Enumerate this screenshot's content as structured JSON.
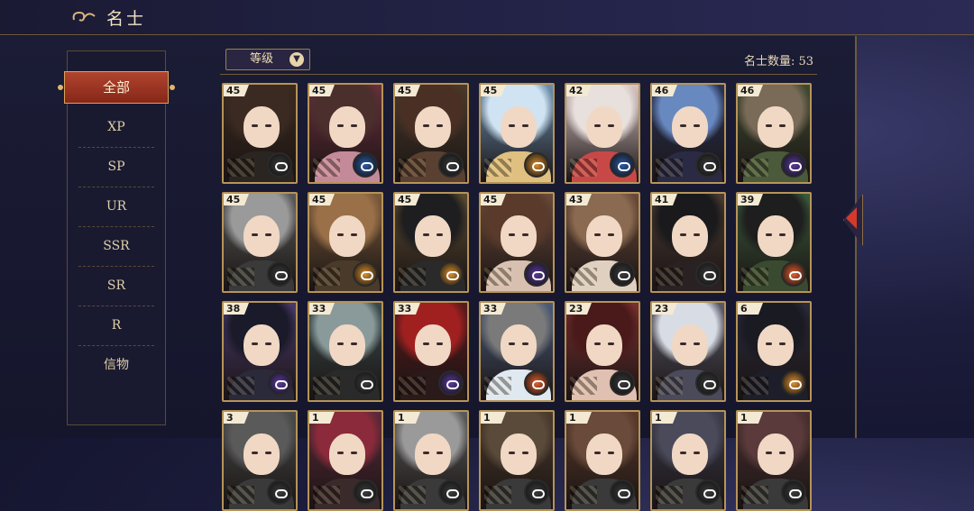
{
  "header": {
    "title": "名士",
    "icon": "cloud-swirl-icon"
  },
  "sidebar": {
    "items": [
      {
        "label": "全部",
        "active": true
      },
      {
        "label": "XP"
      },
      {
        "label": "SP"
      },
      {
        "label": "UR"
      },
      {
        "label": "SSR"
      },
      {
        "label": "SR"
      },
      {
        "label": "R"
      },
      {
        "label": "信物"
      }
    ]
  },
  "toolbar": {
    "sort_label": "等级",
    "sort_icon": "chevron-down-icon",
    "count_text": "名士数量: 53"
  },
  "side_tab": {
    "icon": "arrow-left-icon"
  },
  "cards": [
    {
      "level": "45",
      "hair": "#3a2a22",
      "bg": "#3b2a1e",
      "body": "#2a2520",
      "badge": "#3a3a3a"
    },
    {
      "level": "45",
      "hair": "#4a2f2c",
      "bg": "#6a2f3c",
      "body": "#c58a9a",
      "badge": "#2d5aa6"
    },
    {
      "level": "45",
      "hair": "#4a3024",
      "bg": "#4a3a2a",
      "body": "#5a4030",
      "badge": "#3a3a3a"
    },
    {
      "level": "45",
      "hair": "#cfe3f2",
      "bg": "#6b8fb0",
      "body": "#e0c080",
      "badge": "#d89030"
    },
    {
      "level": "42",
      "hair": "#e8e0dc",
      "bg": "#d8c4c4",
      "body": "#c84848",
      "badge": "#2d5aa6"
    },
    {
      "level": "46",
      "hair": "#6888c0",
      "bg": "#2a3458",
      "body": "#2a2a44",
      "badge": "#3a3a3a"
    },
    {
      "level": "46",
      "hair": "#7a6a58",
      "bg": "#3e4a30",
      "body": "#4a5a3a",
      "badge": "#5a3a9a"
    },
    {
      "level": "45",
      "hair": "#9a9a9a",
      "bg": "#5a5a5a",
      "body": "#3a3a3a",
      "badge": "#3a3a3a"
    },
    {
      "level": "45",
      "hair": "#9a7048",
      "bg": "#7a5a3a",
      "body": "#4a3a2a",
      "badge": "#d89030"
    },
    {
      "level": "45",
      "hair": "#1e1e20",
      "bg": "#5a4a30",
      "body": "#2a2a2a",
      "badge": "#d89030"
    },
    {
      "level": "45",
      "hair": "#5a3a2a",
      "bg": "#6a4a3a",
      "body": "#d8c0b0",
      "badge": "#5a3a9a"
    },
    {
      "level": "43",
      "hair": "#8a6a50",
      "bg": "#6a4a3a",
      "body": "#e0d0c0",
      "badge": "#3a3a3a"
    },
    {
      "level": "41",
      "hair": "#1a1a1c",
      "bg": "#4a3a32",
      "body": "#2a2222",
      "badge": "#3a3a3a"
    },
    {
      "level": "39",
      "hair": "#1e1e1e",
      "bg": "#3a5a3a",
      "body": "#3a4a30",
      "badge": "#e06030"
    },
    {
      "level": "38",
      "hair": "#1a1a2a",
      "bg": "#4a3a6a",
      "body": "#2a2a3a",
      "badge": "#5a3a9a"
    },
    {
      "level": "33",
      "hair": "#8a9a9a",
      "bg": "#3a4a4a",
      "body": "#2a2a2a",
      "badge": "#3a3a3a"
    },
    {
      "level": "33",
      "hair": "#a02020",
      "bg": "#5a1a1a",
      "body": "#2a1a1a",
      "badge": "#5a3a9a"
    },
    {
      "level": "33",
      "hair": "#7a7a7a",
      "bg": "#4a5a7a",
      "body": "#e0e8f0",
      "badge": "#e06030"
    },
    {
      "level": "23",
      "hair": "#4a1a1a",
      "bg": "#7a3030",
      "body": "#e0c0b0",
      "badge": "#3a3a3a"
    },
    {
      "level": "23",
      "hair": "#d8dce4",
      "bg": "#5a5a6a",
      "body": "#4a4a5a",
      "badge": "#3a3a3a"
    },
    {
      "level": "6",
      "hair": "#1a1a22",
      "bg": "#2a2a3a",
      "body": "#1e1e2a",
      "badge": "#e09030"
    },
    {
      "level": "3",
      "hair": "#5a5a5a",
      "bg": "#4a4a4a",
      "body": "#3a3a3a",
      "badge": "#3a3a3a"
    },
    {
      "level": "1",
      "hair": "#8a2a3a",
      "bg": "#5a2a3a",
      "body": "#3a2a2a",
      "badge": "#3a3a3a"
    },
    {
      "level": "1",
      "hair": "#9a9a9a",
      "bg": "#5a5a5a",
      "body": "#3a3a3a",
      "badge": "#3a3a3a"
    },
    {
      "level": "1",
      "hair": "#5a4a3a",
      "bg": "#4a3a2a",
      "body": "#3a3a3a",
      "badge": "#3a3a3a"
    },
    {
      "level": "1",
      "hair": "#6a4a3a",
      "bg": "#5a3a2a",
      "body": "#3a3a3a",
      "badge": "#3a3a3a"
    },
    {
      "level": "1",
      "hair": "#4a4a5a",
      "bg": "#3a3a4a",
      "body": "#3a3a3a",
      "badge": "#3a3a3a"
    },
    {
      "level": "1",
      "hair": "#5a3a3a",
      "bg": "#4a3030",
      "body": "#3a3a3a",
      "badge": "#3a3a3a"
    }
  ]
}
